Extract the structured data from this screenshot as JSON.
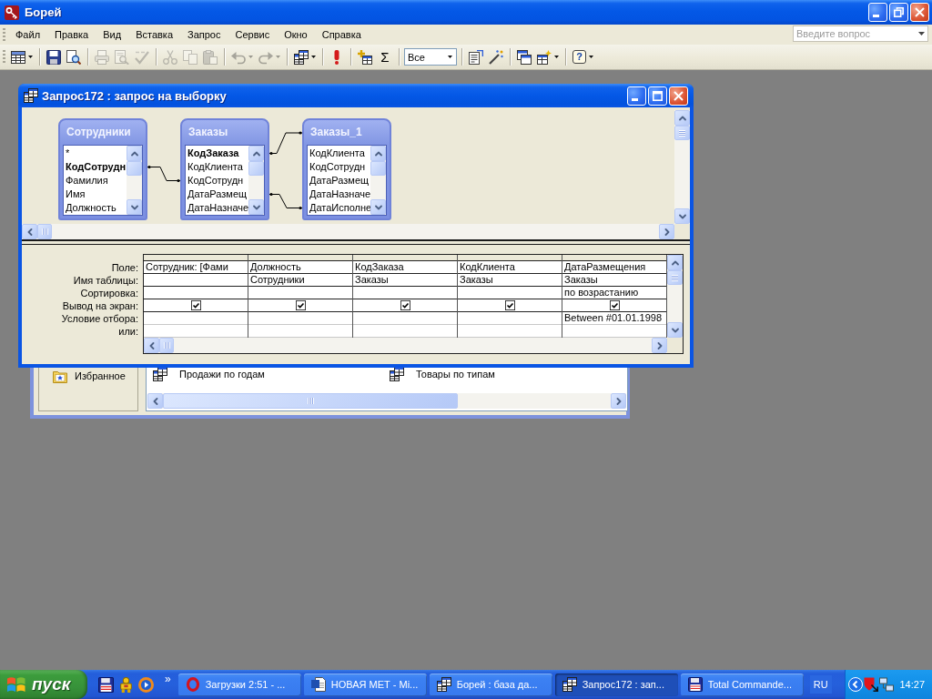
{
  "app_window": {
    "title": "Борей"
  },
  "menu_bar": {
    "items": [
      "Файл",
      "Правка",
      "Вид",
      "Вставка",
      "Запрос",
      "Сервис",
      "Окно",
      "Справка"
    ],
    "question_box": {
      "placeholder": "Введите вопрос"
    }
  },
  "toolbar": {
    "groups": [
      [
        {
          "kind": "button",
          "disabled": false,
          "dropdown": true
        }
      ],
      [
        {
          "kind": "button",
          "disabled": false,
          "dropdown": false
        },
        {
          "kind": "button",
          "disabled": false,
          "dropdown": false
        }
      ],
      [
        {
          "kind": "button",
          "disabled": true,
          "dropdown": false
        },
        {
          "kind": "button",
          "disabled": true,
          "dropdown": false
        },
        {
          "kind": "button",
          "disabled": true,
          "dropdown": false
        }
      ],
      [
        {
          "kind": "button",
          "disabled": true,
          "dropdown": false
        },
        {
          "kind": "button",
          "disabled": true,
          "dropdown": false
        },
        {
          "kind": "button",
          "disabled": true,
          "dropdown": false
        }
      ],
      [
        {
          "kind": "button",
          "disabled": true,
          "dropdown": true
        },
        {
          "kind": "button",
          "disabled": true,
          "dropdown": true
        }
      ],
      [
        {
          "kind": "button",
          "disabled": false,
          "dropdown": true
        }
      ],
      [
        {
          "kind": "button",
          "disabled": false,
          "dropdown": false
        }
      ],
      [
        {
          "kind": "button",
          "disabled": false,
          "dropdown": false
        },
        {
          "kind": "glyph",
          "glyph": "Σ",
          "disabled": false,
          "dropdown": false
        }
      ],
      [
        {
          "kind": "combo",
          "value": "Все"
        }
      ],
      [
        {
          "kind": "button",
          "disabled": false,
          "dropdown": false
        },
        {
          "kind": "button",
          "disabled": false,
          "dropdown": false
        }
      ],
      [
        {
          "kind": "button",
          "disabled": false,
          "dropdown": false
        },
        {
          "kind": "button",
          "disabled": false,
          "dropdown": true
        }
      ],
      [
        {
          "kind": "glyph",
          "glyph": "?",
          "disabled": false,
          "dropdown": true
        }
      ]
    ]
  },
  "query_window": {
    "title": "Запрос172 : запрос на выборку",
    "active": true,
    "tables": [
      {
        "name": "Сотрудники",
        "fields": [
          {
            "label": "*",
            "primary_key": false
          },
          {
            "label": "КодСотрудн",
            "primary_key": true
          },
          {
            "label": "Фамилия",
            "primary_key": false
          },
          {
            "label": "Имя",
            "primary_key": false
          },
          {
            "label": "Должность",
            "primary_key": false
          }
        ]
      },
      {
        "name": "Заказы",
        "fields": [
          {
            "label": "КодЗаказа",
            "primary_key": true
          },
          {
            "label": "КодКлиента",
            "primary_key": false
          },
          {
            "label": "КодСотрудн",
            "primary_key": false
          },
          {
            "label": "ДатаРазмещ",
            "primary_key": false
          },
          {
            "label": "ДатаНазначе",
            "primary_key": false
          }
        ]
      },
      {
        "name": "Заказы_1",
        "fields": [
          {
            "label": "КодКлиента",
            "primary_key": false
          },
          {
            "label": "КодСотрудн",
            "primary_key": false
          },
          {
            "label": "ДатаРазмещ",
            "primary_key": false
          },
          {
            "label": "ДатаНазначе",
            "primary_key": false
          },
          {
            "label": "ДатаИсполне",
            "primary_key": false
          }
        ]
      }
    ],
    "design_grid": {
      "row_labels": [
        "Поле:",
        "Имя таблицы:",
        "Сортировка:",
        "Вывод на экран:",
        "Условие отбора:",
        "или:"
      ],
      "columns": [
        {
          "field": "Сотрудник: [Фами",
          "show": true
        },
        {
          "field": "Должность",
          "table": "Сотрудники",
          "show": true
        },
        {
          "field": "КодЗаказа",
          "table": "Заказы",
          "show": true
        },
        {
          "field": "КодКлиента",
          "table": "Заказы",
          "show": true
        },
        {
          "field": "ДатаРазмещения",
          "table": "Заказы",
          "sort": "по возрастанию",
          "show": true,
          "criteria": "Between #01.01.1998"
        }
      ]
    }
  },
  "database_window": {
    "active": false,
    "groups": [
      {
        "label": "Избранное"
      }
    ],
    "objects": [
      {
        "label": "Продажи по годам"
      },
      {
        "label": "Товары по типам"
      }
    ]
  },
  "taskbar": {
    "start_label": "пуск",
    "more": "»",
    "tasks": [
      {
        "label": "Загрузки 2:51 - ...",
        "selected": false
      },
      {
        "label": "НОВАЯ МЕТ - Mi...",
        "selected": false
      },
      {
        "label": "Борей : база да...",
        "selected": false
      },
      {
        "label": "Запрос172 : зап...",
        "selected": true
      },
      {
        "label": "Total Commande...",
        "selected": false
      }
    ],
    "language": "RU",
    "clock": "14:27"
  }
}
